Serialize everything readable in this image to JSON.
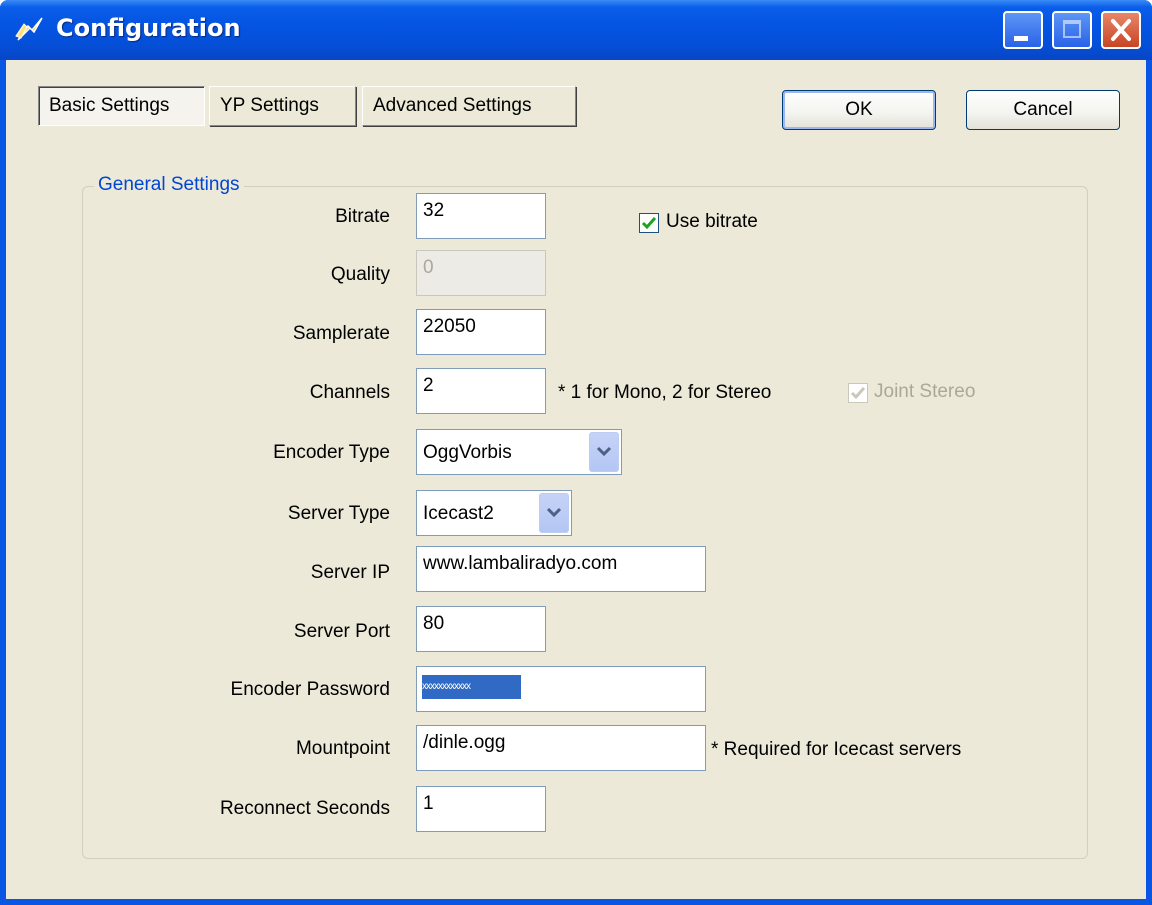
{
  "window": {
    "title": "Configuration"
  },
  "tabs": [
    {
      "label": "Basic Settings",
      "active": true
    },
    {
      "label": "YP Settings",
      "active": false
    },
    {
      "label": "Advanced Settings",
      "active": false
    }
  ],
  "buttons": {
    "ok": "OK",
    "cancel": "Cancel"
  },
  "group": {
    "title": "General Settings"
  },
  "fields": {
    "bitrate": {
      "label": "Bitrate",
      "value": "32"
    },
    "quality": {
      "label": "Quality",
      "value": "0"
    },
    "samplerate": {
      "label": "Samplerate",
      "value": "22050"
    },
    "channels": {
      "label": "Channels",
      "value": "2"
    },
    "encoder_type": {
      "label": "Encoder Type",
      "value": "OggVorbis"
    },
    "server_type": {
      "label": "Server Type",
      "value": "Icecast2"
    },
    "server_ip": {
      "label": "Server IP",
      "value": "www.lambaliradyo.com"
    },
    "server_port": {
      "label": "Server Port",
      "value": "80"
    },
    "encoder_password": {
      "label": "Encoder Password",
      "value": "xxxxxxxxxxxx"
    },
    "mountpoint": {
      "label": "Mountpoint",
      "value": "/dinle.ogg"
    },
    "reconnect_seconds": {
      "label": "Reconnect Seconds",
      "value": "1"
    }
  },
  "checkboxes": {
    "use_bitrate": {
      "label": "Use bitrate",
      "checked": true
    },
    "joint_stereo": {
      "label": "Joint Stereo",
      "checked": true,
      "disabled": true
    }
  },
  "notes": {
    "channels_hint": "* 1 for Mono, 2 for Stereo",
    "mountpoint_hint": "* Required for Icecast servers"
  },
  "colors": {
    "titlebar": "#0554e3",
    "dialog_bg": "#ece9d8",
    "group_title": "#0046d5",
    "selection": "#316ac5",
    "close_button": "#c84424"
  }
}
